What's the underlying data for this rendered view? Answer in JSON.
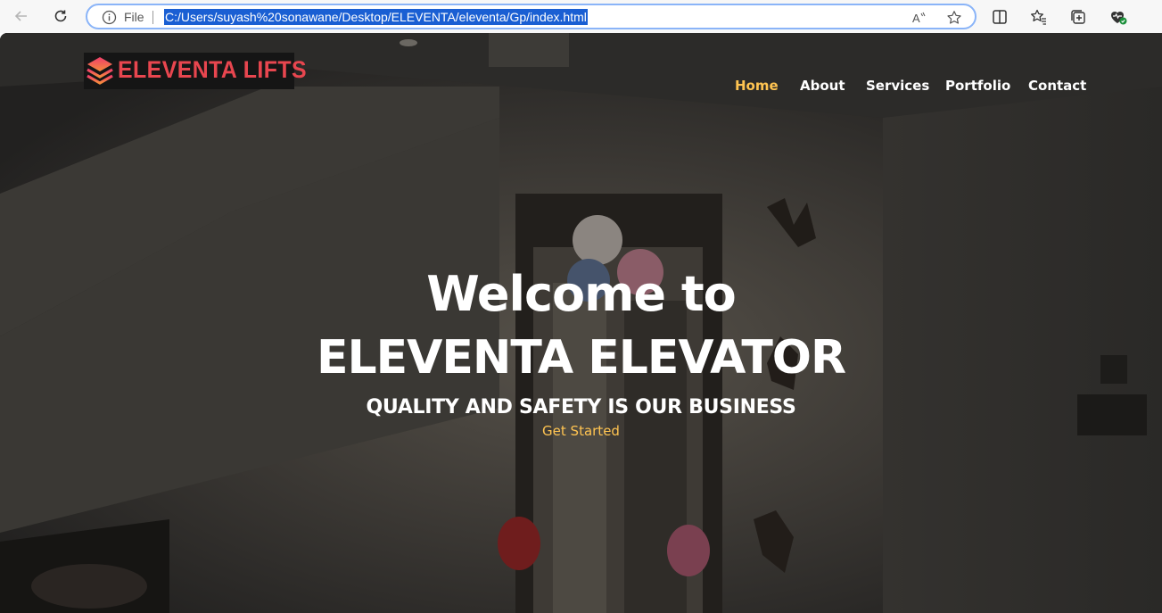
{
  "browser": {
    "scheme_label": "File",
    "url": "C:/Users/suyash%20sonawane/Desktop/ELEVENTA/eleventa/Gp/index.html",
    "icons": [
      "back-arrow-icon",
      "reload-icon",
      "info-icon",
      "read-aloud-icon",
      "star-icon",
      "split-screen-icon",
      "favorites-icon",
      "collections-icon",
      "browser-essentials-icon"
    ]
  },
  "header": {
    "logo_text": "ELEVENTA LIFTS",
    "nav": [
      {
        "label": "Home",
        "active": true
      },
      {
        "label": "About",
        "active": false
      },
      {
        "label": "Services",
        "active": false
      },
      {
        "label": "Portfolio",
        "active": false
      },
      {
        "label": "Contact",
        "active": false
      }
    ]
  },
  "hero": {
    "title_line1": "Welcome to",
    "title_line2": "ELEVENTA ELEVATOR",
    "subtitle": "QUALITY AND SAFETY IS OUR BUSINESS",
    "cta_label": "Get Started"
  },
  "colors": {
    "accent": "#ffc451",
    "logo_red": "#e8464f",
    "overlay": "#2d2c2a"
  }
}
